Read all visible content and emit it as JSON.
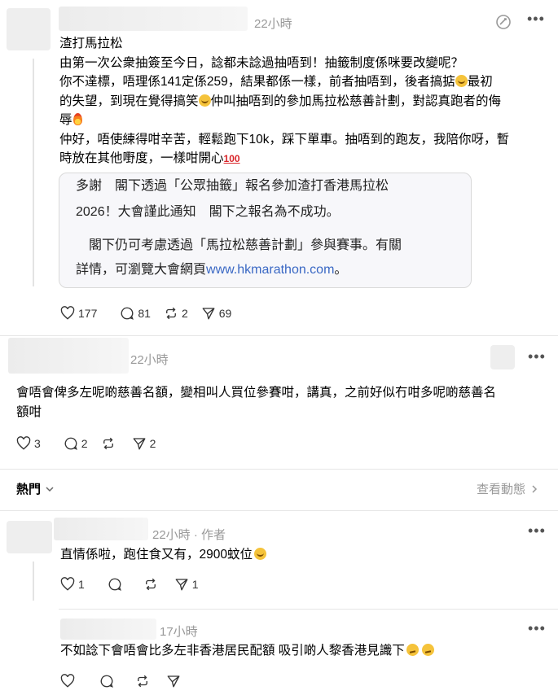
{
  "post": {
    "time": "22小時",
    "title": "渣打馬拉松",
    "line1": "由第一次公衆抽簽至今日，諗都未諗過抽唔到！抽籤制度係咪要改變呢？",
    "line2": "你不達標，唔理係141定係259，結果都係一樣，前者抽唔到，後者搞掂",
    "line2_end": "最初",
    "line3a": "的失望，到現在覺得搞笑",
    "line3b": "仲叫抽唔到的參加馬拉松慈善計劃，對認真跑者的侮",
    "line4": "辱",
    "line5": "仲好，唔使練得咁辛苦，輕鬆跑下10k，踩下單車。抽唔到的跑友，我陪你呀，暫",
    "line6": "時放在其他嘢度，一樣咁開心",
    "hundred": "100",
    "card": {
      "l1": "多謝　閣下透過「公眾抽籤」報名參加渣打香港馬拉松",
      "l2": "2026！大會謹此通知　閣下之報名為不成功。",
      "l3": "　閣下仍可考慮透過「馬拉松慈善計劃」參與賽事。有關",
      "l4": "詳情，可瀏覽大會網頁",
      "link": "www.hkmarathon.com",
      "l4_end": "。"
    },
    "likes": "177",
    "comments": "81",
    "reposts": "2",
    "shares": "69"
  },
  "reply1": {
    "time": "22小時",
    "line1": "會唔會俾多左呢啲慈善名額，變相叫人買位參賽咁，講真，之前好似冇咁多呢啲慈善名",
    "line2": "額咁",
    "likes": "3",
    "comments": "2",
    "shares": "2"
  },
  "sort": {
    "label": "熱門",
    "activity": "查看動態"
  },
  "reply2": {
    "time": "22小時",
    "author_tag": "作者",
    "text": "直情係啦，跑住食又有，2900蚊位",
    "likes": "1",
    "shares": "1"
  },
  "reply3": {
    "time": "17小時",
    "text": "不如諗下會唔會比多左非香港居民配額 吸引啲人黎香港見識下"
  },
  "colors": {
    "link": "#3a68c4",
    "muted": "#999999",
    "divider": "#e6e6e6"
  }
}
